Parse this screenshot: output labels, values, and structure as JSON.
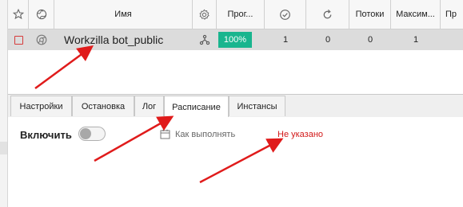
{
  "grid": {
    "headers": {
      "name": "Имя",
      "progress": "Прог...",
      "threads": "Потоки",
      "max": "Максим...",
      "last": "Пр"
    },
    "row": {
      "name": "Workzilla bot_public",
      "progress": "100%",
      "success": "1",
      "repeat": "0",
      "threads": "0",
      "max": "1"
    }
  },
  "tabs": [
    {
      "label": "Настройки",
      "active": false
    },
    {
      "label": "Остановка",
      "active": false
    },
    {
      "label": "Лог",
      "active": false
    },
    {
      "label": "Расписание",
      "active": true
    },
    {
      "label": "Инстансы",
      "active": false
    }
  ],
  "schedule": {
    "enable_label": "Включить",
    "enabled": false,
    "how_label": "Как выполнять",
    "how_value": "Не указано"
  },
  "colors": {
    "progress_fill": "#19b58e",
    "arrow": "#e01b1b",
    "not_set": "#d21919"
  }
}
